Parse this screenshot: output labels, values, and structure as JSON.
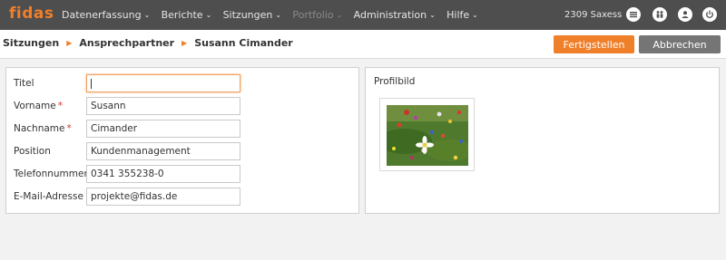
{
  "app": {
    "logo": "fidas"
  },
  "nav": [
    {
      "label": "Datenerfassung",
      "enabled": true
    },
    {
      "label": "Berichte",
      "enabled": true
    },
    {
      "label": "Sitzungen",
      "enabled": true
    },
    {
      "label": "Portfolio",
      "enabled": false
    },
    {
      "label": "Administration",
      "enabled": true
    },
    {
      "label": "Hilfe",
      "enabled": true
    }
  ],
  "user": {
    "name": "2309 Saxess"
  },
  "icons": [
    "list-icon",
    "people-icon",
    "user-icon",
    "power-icon"
  ],
  "breadcrumb": [
    "Sitzungen",
    "Ansprechpartner",
    "Susann Cimander"
  ],
  "actions": {
    "finish": "Fertigstellen",
    "cancel": "Abbrechen"
  },
  "form": {
    "fields": [
      {
        "label": "Titel",
        "value": "",
        "required": false
      },
      {
        "label": "Vorname",
        "value": "Susann",
        "required": true
      },
      {
        "label": "Nachname",
        "value": "Cimander",
        "required": true
      },
      {
        "label": "Position",
        "value": "Kundenmanagement",
        "required": false
      },
      {
        "label": "Telefonnummer",
        "value": "0341 355238-0",
        "required": false
      },
      {
        "label": "E-Mail-Adresse",
        "value": "projekte@fidas.de",
        "required": false
      }
    ]
  },
  "profile": {
    "label": "Profilbild"
  },
  "colors": {
    "accent": "#f07f2a",
    "topbar": "#4e4e4e",
    "secondary_button": "#757575"
  }
}
